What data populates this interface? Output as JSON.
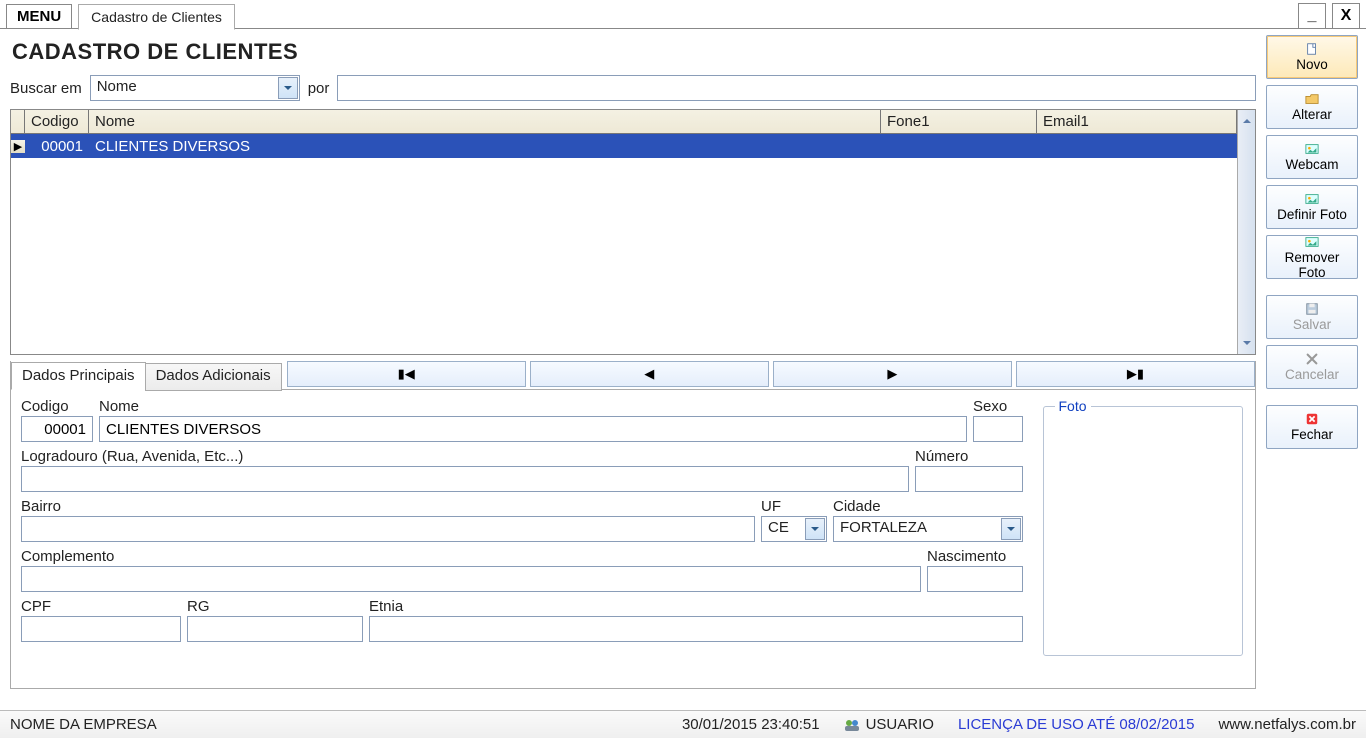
{
  "top": {
    "menu": "MENU",
    "tab": "Cadastro de Clientes",
    "minimize": "_",
    "close": "X"
  },
  "page_title": "CADASTRO DE CLIENTES",
  "search": {
    "label_buscar": "Buscar em",
    "field": "Nome",
    "label_por": "por",
    "value": ""
  },
  "grid": {
    "columns": {
      "codigo": "Codigo",
      "nome": "Nome",
      "fone1": "Fone1",
      "email1": "Email1"
    },
    "row": {
      "codigo": "00001",
      "nome": "CLIENTES DIVERSOS",
      "fone1": "",
      "email1": ""
    }
  },
  "tabs": {
    "main": "Dados Principais",
    "add": "Dados Adicionais"
  },
  "nav": {
    "first": "⏮",
    "prev": "◀",
    "next": "▶",
    "last": "⏭"
  },
  "form": {
    "codigo_lbl": "Codigo",
    "codigo": "00001",
    "nome_lbl": "Nome",
    "nome": "CLIENTES DIVERSOS",
    "sexo_lbl": "Sexo",
    "sexo": "",
    "logradouro_lbl": "Logradouro (Rua, Avenida, Etc...)",
    "logradouro": "",
    "numero_lbl": "Número",
    "numero": "",
    "bairro_lbl": "Bairro",
    "bairro": "",
    "uf_lbl": "UF",
    "uf": "CE",
    "cidade_lbl": "Cidade",
    "cidade": "FORTALEZA",
    "complemento_lbl": "Complemento",
    "complemento": "",
    "nascimento_lbl": "Nascimento",
    "nascimento": "",
    "cpf_lbl": "CPF",
    "cpf": "",
    "rg_lbl": "RG",
    "rg": "",
    "etnia_lbl": "Etnia",
    "etnia": "",
    "foto_lbl": "Foto"
  },
  "side": {
    "novo": "Novo",
    "alterar": "Alterar",
    "webcam": "Webcam",
    "definir": "Definir Foto",
    "remover": "Remover Foto",
    "salvar": "Salvar",
    "cancelar": "Cancelar",
    "fechar": "Fechar"
  },
  "status": {
    "empresa": "NOME DA EMPRESA",
    "datetime": "30/01/2015 23:40:51",
    "user": "USUARIO",
    "licenca": "LICENÇA DE USO ATÉ 08/02/2015",
    "site": "www.netfalys.com.br"
  }
}
